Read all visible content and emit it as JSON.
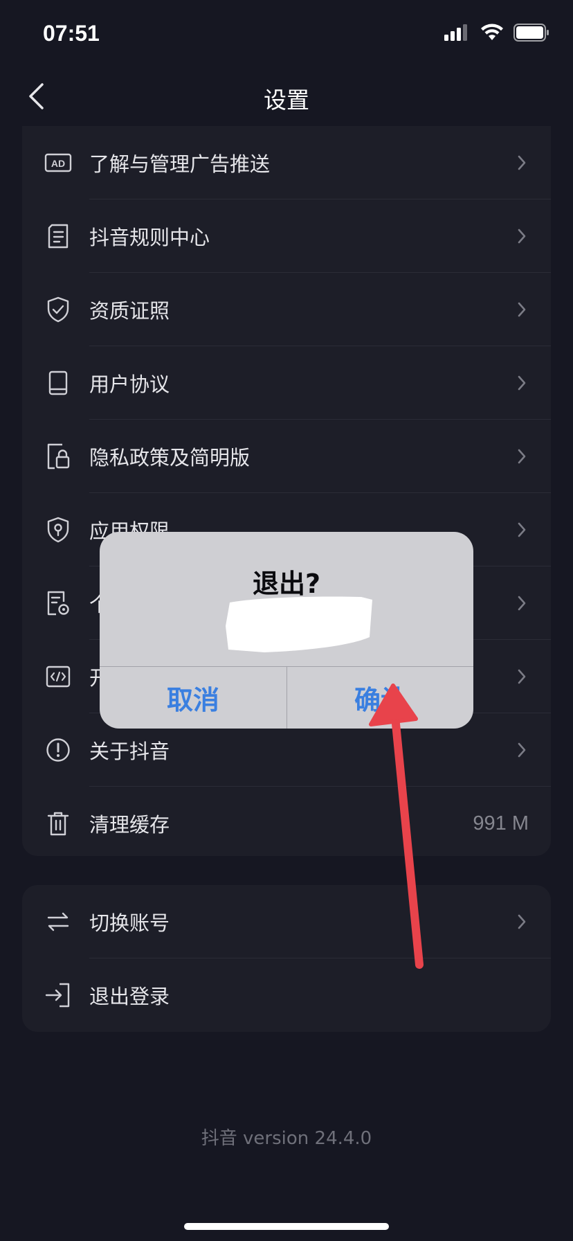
{
  "status_bar": {
    "time": "07:51"
  },
  "nav": {
    "title": "设置"
  },
  "settings_main": [
    {
      "label": "了解与管理广告推送",
      "icon": "ad-icon",
      "right": "chevron"
    },
    {
      "label": "抖音规则中心",
      "icon": "document-list-icon",
      "right": "chevron"
    },
    {
      "label": "资质证照",
      "icon": "shield-check-icon",
      "right": "chevron"
    },
    {
      "label": "用户协议",
      "icon": "book-icon",
      "right": "chevron"
    },
    {
      "label": "隐私政策及简明版",
      "icon": "privacy-lock-icon",
      "right": "chevron"
    },
    {
      "label": "应用权限",
      "icon": "shield-key-icon",
      "right": "chevron"
    },
    {
      "label": "个",
      "icon": "document-settings-icon",
      "right": "chevron"
    },
    {
      "label": "开",
      "icon": "code-icon",
      "right": "chevron"
    },
    {
      "label": "关于抖音",
      "icon": "info-circle-icon",
      "right": "chevron"
    },
    {
      "label": "清理缓存",
      "icon": "trash-icon",
      "right_value": "991 M"
    }
  ],
  "settings_account": [
    {
      "label": "切换账号",
      "icon": "switch-arrows-icon",
      "right": "chevron"
    },
    {
      "label": "退出登录",
      "icon": "logout-icon"
    }
  ],
  "footer": {
    "version": "抖音 version 24.4.0"
  },
  "dialog": {
    "title": "退出?",
    "cancel_label": "取消",
    "confirm_label": "确认"
  },
  "colors": {
    "background": "#161722",
    "card": "#1d1e28",
    "dialog_bg": "#cfcfd3",
    "dialog_button": "#3a7fe0",
    "annotation_arrow": "#e8434b"
  }
}
